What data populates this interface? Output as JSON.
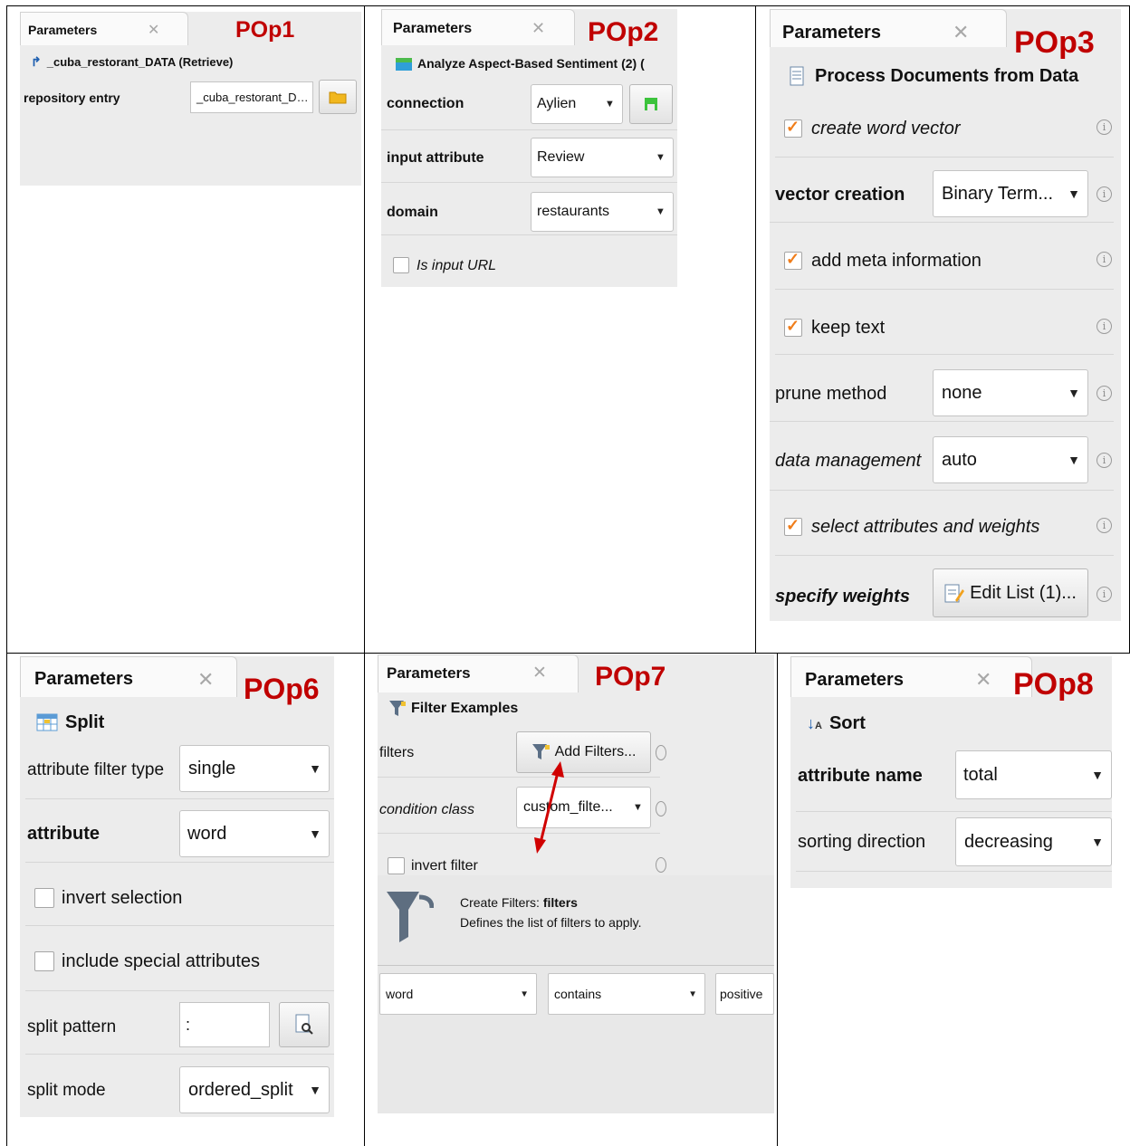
{
  "common": {
    "parameters": "Parameters",
    "close_glyph": "✕",
    "arrow_glyph": "▼",
    "info_glyph": "i"
  },
  "pop1": {
    "tag": "POp1",
    "operator": "_cuba_restorant_DATA (Retrieve)",
    "operator_icon": "retrieve-icon",
    "repository_entry_label": "repository entry",
    "repository_entry_value": "_cuba_restorant_D…",
    "folder_icon": "folder-icon"
  },
  "pop2": {
    "tag": "POp2",
    "operator": "Analyze Aspect-Based Sentiment (2) (",
    "connection_label": "connection",
    "connection_value": "Aylien",
    "input_attribute_label": "input attribute",
    "input_attribute_value": "Review",
    "domain_label": "domain",
    "domain_value": "restaurants",
    "is_input_url_label": "Is input URL",
    "is_input_url_checked": false
  },
  "pop3": {
    "tag": "POp3",
    "operator": "Process Documents from Data",
    "create_word_vector_label": "create word vector",
    "vector_creation_label": "vector creation",
    "vector_creation_value": "Binary Term...",
    "add_meta_information_label": "add meta information",
    "keep_text_label": "keep text",
    "prune_method_label": "prune method",
    "prune_method_value": "none",
    "data_management_label": "data management",
    "data_management_value": "auto",
    "select_attributes_label": "select attributes and weights",
    "specify_weights_label": "specify weights",
    "edit_list_label": "Edit List (1)..."
  },
  "pop6": {
    "tag": "POp6",
    "operator": "Split",
    "attribute_filter_type_label": "attribute filter type",
    "attribute_filter_type_value": "single",
    "attribute_label": "attribute",
    "attribute_value": "word",
    "invert_selection_label": "invert selection",
    "include_special_label": "include special attributes",
    "split_pattern_label": "split pattern",
    "split_pattern_value": ":",
    "split_mode_label": "split mode",
    "split_mode_value": "ordered_split"
  },
  "pop7": {
    "tag": "POp7",
    "operator": "Filter Examples",
    "filters_label": "filters",
    "add_filters_label": "Add Filters...",
    "condition_class_label": "condition class",
    "condition_class_value": "custom_filte...",
    "invert_filter_label": "invert filter",
    "create_filters_prefix": "Create Filters: ",
    "create_filters_name": "filters",
    "create_filters_desc": "Defines the list of filters to apply.",
    "filter_attribute": "word",
    "filter_operator": "contains",
    "filter_value": "positive",
    "arrow_color": "#d00000"
  },
  "pop8": {
    "tag": "POp8",
    "operator": "Sort",
    "attribute_name_label": "attribute name",
    "attribute_name_value": "total",
    "sorting_direction_label": "sorting direction",
    "sorting_direction_value": "decreasing"
  }
}
